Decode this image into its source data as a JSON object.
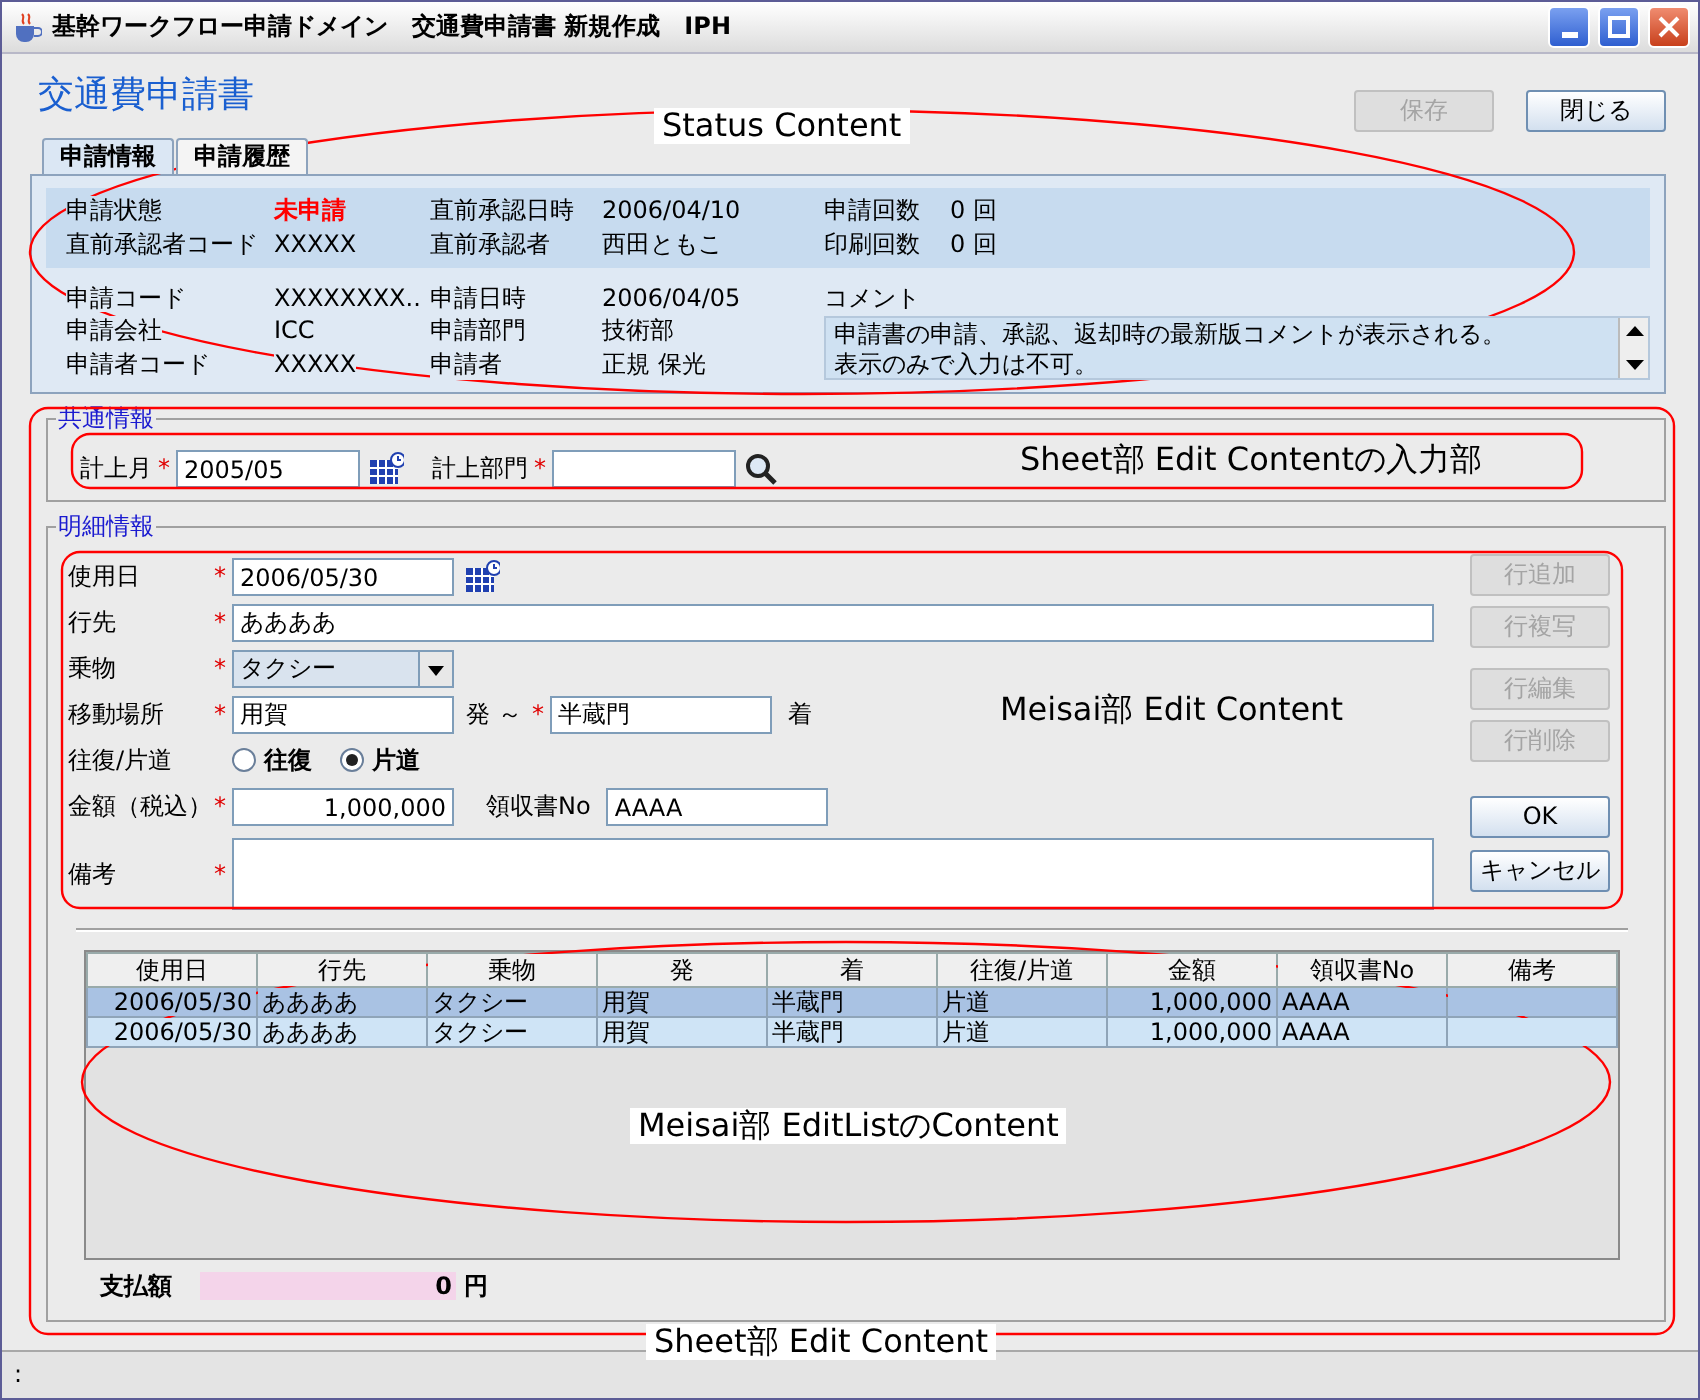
{
  "window": {
    "title": "基幹ワークフロー申請ドメイン　交通費申請書 新規作成　IPH"
  },
  "header": {
    "title": "交通費申請書",
    "buttons": [
      {
        "label": "保存",
        "disabled": true
      },
      {
        "label": "閉じる",
        "disabled": false
      }
    ]
  },
  "tabs": [
    {
      "label": "申請情報",
      "selected": true
    },
    {
      "label": "申請履歴",
      "selected": false
    }
  ],
  "status": {
    "band": [
      [
        {
          "label": "申請状態",
          "value": "未申請",
          "alert": true
        },
        {
          "label": "直前承認日時",
          "value": "2006/04/10",
          "alert": false
        },
        {
          "label": "申請回数",
          "value": "0 回",
          "alert": false
        }
      ],
      [
        {
          "label": "直前承認者コード",
          "value": "XXXXX",
          "alert": false
        },
        {
          "label": "直前承認者",
          "value": "西田ともこ",
          "alert": false
        },
        {
          "label": "印刷回数",
          "value": "0 回",
          "alert": false
        }
      ]
    ],
    "details": [
      [
        {
          "label": "申請コード",
          "value": "XXXXXXXX.."
        },
        {
          "label": "申請日時",
          "value": "2006/04/05"
        }
      ],
      [
        {
          "label": "申請会社",
          "value": "ICC"
        },
        {
          "label": "申請部門",
          "value": "技術部"
        }
      ],
      [
        {
          "label": "申請者コード",
          "value": "XXXXX"
        },
        {
          "label": "申請者",
          "value": "正規 保光"
        }
      ]
    ],
    "comment": {
      "label": "コメント",
      "lines": [
        "申請書の申請、承認、返却時の最新版コメントが表示される。",
        "表示のみで入力は不可。"
      ]
    }
  },
  "required_mark": "*",
  "common": {
    "title": "共通情報",
    "fields": [
      {
        "kind": "date",
        "label": "計上月",
        "required": true,
        "value": "2005/05"
      },
      {
        "kind": "lookup",
        "label": "計上部門",
        "required": true
      }
    ]
  },
  "detail": {
    "title": "明細情報",
    "rows": [
      {
        "kind": "date",
        "label": "使用日",
        "required": true,
        "value": "2006/05/30"
      },
      {
        "kind": "text",
        "label": "行先",
        "required": true,
        "value": "ああああ"
      },
      {
        "kind": "select",
        "label": "乗物",
        "required": true,
        "value": "タクシー"
      },
      {
        "kind": "route",
        "label": "移動場所",
        "required": true,
        "from": "用賀",
        "from_suffix": "発",
        "separator": "～",
        "to_required": true,
        "to": "半蔵門",
        "to_suffix": "着"
      },
      {
        "kind": "radio",
        "label": "往復/片道",
        "options": [
          {
            "label": "往復",
            "selected": false
          },
          {
            "label": "片道",
            "selected": true
          }
        ]
      },
      {
        "kind": "amount",
        "label": "金額（税込）",
        "required": true,
        "value": "1,000,000",
        "receipt_label": "領収書No",
        "receipt": "AAAA"
      },
      {
        "kind": "memo",
        "label": "備考",
        "required": true
      }
    ],
    "row_buttons": [
      {
        "label": "行追加",
        "disabled": true
      },
      {
        "label": "行複写",
        "disabled": true
      },
      {
        "label": "行編集",
        "disabled": true
      },
      {
        "label": "行削除",
        "disabled": true
      }
    ],
    "confirm_buttons": [
      {
        "label": "OK",
        "disabled": false
      },
      {
        "label": "キャンセル",
        "disabled": false
      }
    ],
    "table": {
      "columns": [
        {
          "label": "使用日",
          "kind": "date"
        },
        {
          "label": "行先",
          "kind": "text"
        },
        {
          "label": "乗物",
          "kind": "text"
        },
        {
          "label": "発",
          "kind": "text"
        },
        {
          "label": "着",
          "kind": "text"
        },
        {
          "label": "往復/片道",
          "kind": "text"
        },
        {
          "label": "金額",
          "kind": "number"
        },
        {
          "label": "領収書No",
          "kind": "text"
        },
        {
          "label": "備考",
          "kind": "text"
        }
      ],
      "rows": [
        {
          "selected": true,
          "cells": [
            "2006/05/30",
            "ああああ",
            "タクシー",
            "用賀",
            "半蔵門",
            "片道",
            "1,000,000",
            "AAAA"
          ]
        },
        {
          "selected": false,
          "cells": [
            "2006/05/30",
            "ああああ",
            "タクシー",
            "用賀",
            "半蔵門",
            "片道",
            "1,000,000",
            "AAAA"
          ]
        }
      ]
    },
    "total": {
      "label": "支払額",
      "value": "0",
      "unit": "円"
    }
  },
  "annotations": [
    {
      "kind": "ellipse",
      "label": "Status Content"
    },
    {
      "kind": "frame",
      "label": "Sheet部 Edit Contentの入力部"
    },
    {
      "kind": "frame",
      "label": "Meisai部 Edit Content"
    },
    {
      "kind": "ellipse",
      "label": "Meisai部 EditListのContent"
    },
    {
      "kind": "frame",
      "label": "Sheet部 Edit Content"
    }
  ],
  "status_bar": ":"
}
